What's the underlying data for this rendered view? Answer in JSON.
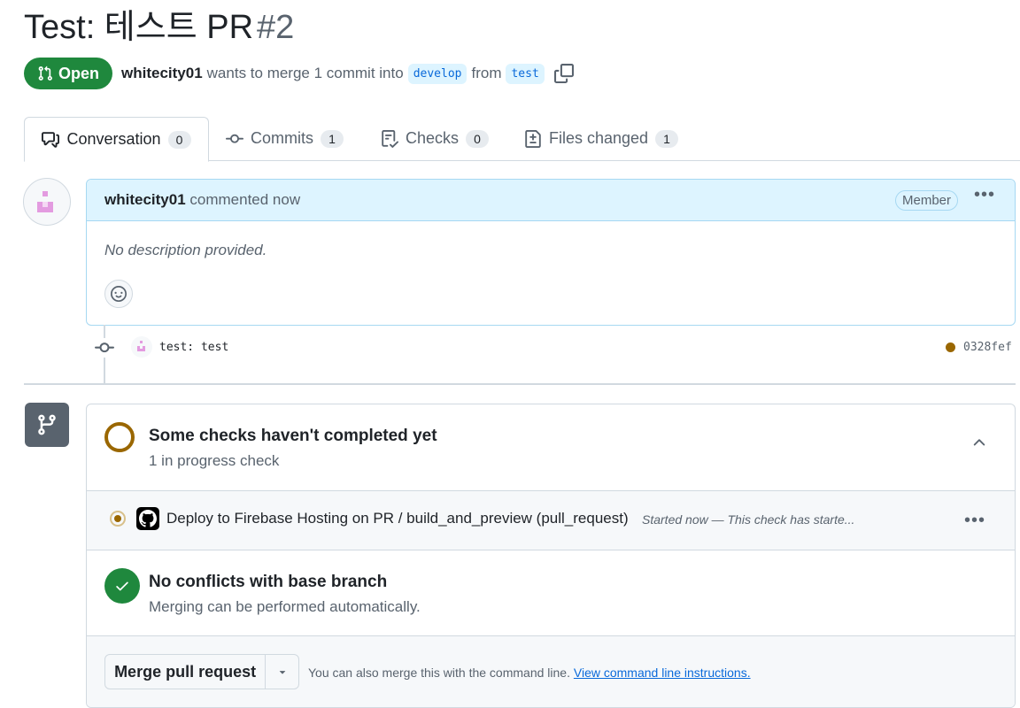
{
  "pr": {
    "title": "Test: 테스트 PR",
    "number": "#2",
    "state": "Open",
    "author": "whitecity01",
    "summary_text": "wants to merge 1 commit into",
    "base_branch": "develop",
    "from_text": "from",
    "head_branch": "test"
  },
  "tabs": [
    {
      "label": "Conversation",
      "count": "0",
      "icon": "comment-discussion-icon"
    },
    {
      "label": "Commits",
      "count": "1",
      "icon": "git-commit-icon"
    },
    {
      "label": "Checks",
      "count": "0",
      "icon": "checklist-icon"
    },
    {
      "label": "Files changed",
      "count": "1",
      "icon": "file-diff-icon"
    }
  ],
  "comment": {
    "author": "whitecity01",
    "action": "commented now",
    "role_badge": "Member",
    "body": "No description provided."
  },
  "commit": {
    "message": "test: test",
    "sha": "0328fef",
    "status_color": "#9a6700"
  },
  "checks": {
    "heading": "Some checks haven't completed yet",
    "subheading": "1 in progress check",
    "items": [
      {
        "name": "Deploy to Firebase Hosting on PR / build_and_preview (pull_request)",
        "description": "Started now — This check has starte..."
      }
    ]
  },
  "conflicts": {
    "heading": "No conflicts with base branch",
    "subheading": "Merging can be performed automatically."
  },
  "merge": {
    "button_label": "Merge pull request",
    "hint": "You can also merge this with the command line.",
    "link": "View command line instructions."
  },
  "colors": {
    "open_green": "#1f883d",
    "pending": "#9a6700",
    "link_blue": "#0969da",
    "comment_header_bg": "#ddf4ff"
  }
}
